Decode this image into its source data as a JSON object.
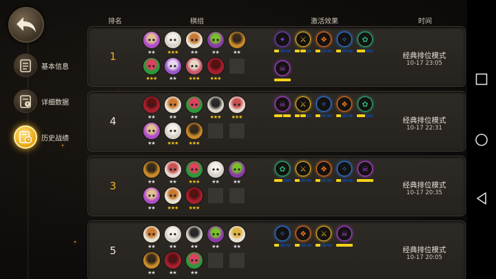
{
  "header": {
    "rank": "排名",
    "lineup": "棋组",
    "traits": "激活效果",
    "time": "时间"
  },
  "sidebar": [
    {
      "label": "基本信息",
      "icon": "clipboard-icon",
      "active": false
    },
    {
      "label": "详细数据",
      "icon": "clipboard-alert-icon",
      "active": false
    },
    {
      "label": "历史战绩",
      "icon": "history-clock-icon",
      "active": true
    }
  ],
  "matches": [
    {
      "rank": "1",
      "rank_color": "gold",
      "pieces": [
        [
          {
            "c": "#b04dc8",
            "h": "#e0c090",
            "s": 2
          },
          {
            "c": "#d8d2c8",
            "h": "#f4f0ea",
            "s": 3
          },
          {
            "c": "#e8e2d4",
            "h": "#c87830",
            "s": 2
          },
          {
            "c": "#8a3aa8",
            "h": "#7ac02a",
            "s": 2
          },
          {
            "c": "#c88a2a",
            "h": "#3a2a1a",
            "s": 2
          }
        ],
        [
          {
            "c": "#2a9a3a",
            "h": "#e04060",
            "s": 3
          },
          {
            "c": "#9a58c8",
            "h": "#e8d8f0",
            "s": 2
          },
          {
            "c": "#c85a6a",
            "h": "#e8d8c8",
            "s": 3
          },
          {
            "c": "#a82030",
            "h": "#5a1010",
            "s": 3
          },
          {
            "empty": true
          }
        ]
      ],
      "traits": [
        [
          {
            "c": "#7a3ac8",
            "g": "✦",
            "bar": [
              1,
              0,
              0
            ]
          },
          {
            "c": "#e6b020",
            "g": "⚔",
            "bar": [
              1,
              1,
              0
            ]
          },
          {
            "c": "#e07020",
            "g": "❖",
            "bar": [
              1,
              0,
              0
            ]
          },
          {
            "c": "#2a7ae0",
            "g": "✧",
            "bar": [
              1,
              0,
              0
            ]
          },
          {
            "c": "#2ab07a",
            "g": "✿",
            "bar": [
              1,
              0
            ]
          }
        ],
        [
          {
            "c": "#b040d8",
            "g": "☠",
            "bar": [
              1
            ]
          }
        ]
      ],
      "mode": "经典排位模式",
      "time": "10-17 23:05"
    },
    {
      "rank": "4",
      "rank_color": "white",
      "pieces": [
        [
          {
            "c": "#a82030",
            "h": "#5a1010",
            "s": 2
          },
          {
            "c": "#e8e2d4",
            "h": "#c87830",
            "s": 2
          },
          {
            "c": "#2a9a3a",
            "h": "#e04060",
            "s": 2
          },
          {
            "c": "#d8d2c8",
            "h": "#2a2a2a",
            "s": 3
          },
          {
            "c": "#e8d8d0",
            "h": "#c85050",
            "s": 3
          }
        ],
        [
          {
            "c": "#b04dc8",
            "h": "#e0c090",
            "s": 2
          },
          {
            "c": "#d8d2c8",
            "h": "#f4f0ea",
            "s": 3
          },
          {
            "c": "#c88a2a",
            "h": "#3a2a1a",
            "s": 3
          },
          {
            "empty": true
          },
          {
            "empty": true
          }
        ]
      ],
      "traits": [
        [
          {
            "c": "#b040d8",
            "g": "☠",
            "bar": [
              1,
              1
            ]
          },
          {
            "c": "#e6b020",
            "g": "⚔",
            "bar": [
              1,
              1,
              0
            ]
          },
          {
            "c": "#2a7ae0",
            "g": "✧",
            "bar": [
              1,
              0,
              0
            ]
          },
          {
            "c": "#e07020",
            "g": "❖",
            "bar": [
              1,
              0,
              0
            ]
          },
          {
            "c": "#2ab07a",
            "g": "✿",
            "bar": [
              1,
              0
            ]
          }
        ]
      ],
      "mode": "经典排位模式",
      "time": "10-17 22:31"
    },
    {
      "rank": "3",
      "rank_color": "gold",
      "pieces": [
        [
          {
            "c": "#c88a2a",
            "h": "#3a2a1a",
            "s": 2
          },
          {
            "c": "#e8d8d0",
            "h": "#c85050",
            "s": 2
          },
          {
            "c": "#2a9a3a",
            "h": "#e04060",
            "s": 3
          },
          {
            "c": "#d8d2c8",
            "h": "#f4f0ea",
            "s": 2
          },
          {
            "c": "#8a3aa8",
            "h": "#7ac02a",
            "s": 2
          }
        ],
        [
          {
            "c": "#b04dc8",
            "h": "#e0c090",
            "s": 2
          },
          {
            "c": "#e8e2d4",
            "h": "#c87830",
            "s": 3
          },
          {
            "c": "#a82030",
            "h": "#5a1010",
            "s": 3
          },
          {
            "empty": true
          },
          {
            "empty": true
          }
        ]
      ],
      "traits": [
        [
          {
            "c": "#2ab07a",
            "g": "✿",
            "bar": [
              1,
              0
            ]
          },
          {
            "c": "#e6b020",
            "g": "⚔",
            "bar": [
              1,
              0,
              0
            ]
          },
          {
            "c": "#e07020",
            "g": "❖",
            "bar": [
              1,
              0,
              0
            ]
          },
          {
            "c": "#2a7ae0",
            "g": "✧",
            "bar": [
              1,
              0,
              0
            ]
          },
          {
            "c": "#b040d8",
            "g": "☠",
            "bar": [
              1
            ]
          }
        ]
      ],
      "mode": "经典排位模式",
      "time": "10-17 20:35"
    },
    {
      "rank": "5",
      "rank_color": "white",
      "pieces": [
        [
          {
            "c": "#e8e2d4",
            "h": "#c87830",
            "s": 2
          },
          {
            "c": "#d8d2c8",
            "h": "#f4f0ea",
            "s": 2
          },
          {
            "c": "#d8d2c8",
            "h": "#2a2a2a",
            "s": 2
          },
          {
            "c": "#8a3aa8",
            "h": "#7ac02a",
            "s": 2
          },
          {
            "c": "#e8e2d4",
            "h": "#e0b040",
            "s": 2
          }
        ],
        [
          {
            "c": "#c88a2a",
            "h": "#3a2a1a",
            "s": 2
          },
          {
            "c": "#a82030",
            "h": "#5a1010",
            "s": 2
          },
          {
            "c": "#2a9a3a",
            "h": "#e04060",
            "s": 2
          },
          {
            "empty": true
          },
          {
            "empty": true
          }
        ]
      ],
      "traits": [
        [
          {
            "c": "#2a7ae0",
            "g": "✧",
            "bar": [
              1,
              0,
              0
            ]
          },
          {
            "c": "#e07020",
            "g": "❖",
            "bar": [
              1,
              0,
              0
            ]
          },
          {
            "c": "#e6b020",
            "g": "⚔",
            "bar": [
              1,
              0,
              0
            ]
          },
          {
            "c": "#b040d8",
            "g": "☠",
            "bar": [
              1
            ]
          }
        ]
      ],
      "mode": "经典排位模式",
      "time": "10-17 20:05"
    }
  ]
}
